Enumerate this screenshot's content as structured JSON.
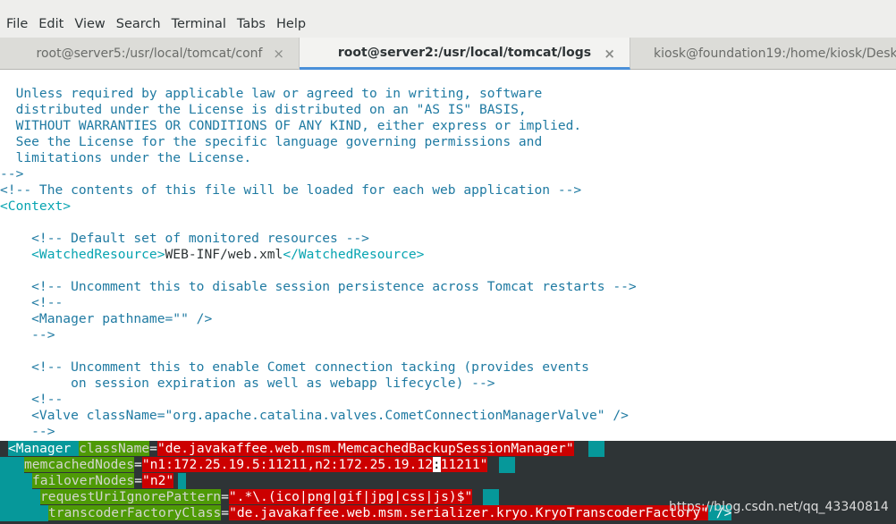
{
  "menu": [
    "File",
    "Edit",
    "View",
    "Search",
    "Terminal",
    "Tabs",
    "Help"
  ],
  "tabs": [
    {
      "label": "root@server5:/usr/local/tomcat/conf",
      "active": false,
      "close": "×"
    },
    {
      "label": "root@server2:/usr/local/tomcat/logs",
      "active": true,
      "close": "×"
    },
    {
      "label": "kiosk@foundation19:/home/kiosk/Deskt",
      "active": false
    }
  ],
  "terminal": {
    "l1": "  Unless required by applicable law or agreed to in writing, software",
    "l2": "  distributed under the License is distributed on an \"AS IS\" BASIS,",
    "l3": "  WITHOUT WARRANTIES OR CONDITIONS OF ANY KIND, either express or implied.",
    "l4": "  See the License for the specific language governing permissions and",
    "l5": "  limitations under the License.",
    "l6": "-->",
    "l7": "<!-- The contents of this file will be loaded for each web application -->",
    "l8": "<Context>",
    "l10": "    <!-- Default set of monitored resources -->",
    "l11_open": "    <WatchedResource>",
    "l11_text": "WEB-INF/web.xml",
    "l11_close": "</WatchedResource>",
    "l13": "    <!-- Uncomment this to disable session persistence across Tomcat restarts -->",
    "l14": "    <!--",
    "l15": "    <Manager pathname=\"\" />",
    "l16": "    -->",
    "l18": "    <!-- Uncomment this to enable Comet connection tacking (provides events",
    "l19": "         on session expiration as well as webapp lifecycle) -->",
    "l20": "    <!--",
    "l21": "    <Valve className=\"org.apache.catalina.valves.CometConnectionManagerValve\" />",
    "l22": "    -->"
  },
  "highlight": {
    "r1_tag": "<Manager ",
    "r1_attr": "className",
    "r1_eq": "=",
    "r1_val": "\"de.javakaffee.web.msm.MemcachedBackupSessionManager\"",
    "r2_attr": "memcachedNodes",
    "r2_eq": "=",
    "r2_val_a": "\"n1:172.25.19.5:11211,n2:172.25.19.12",
    "r2_cursor": ":",
    "r2_val_b": "11211\"",
    "r3_attr": "failoverNodes",
    "r3_eq": "=",
    "r3_val": "\"n2\"",
    "r4_attr": "requestUriIgnorePattern",
    "r4_eq": "=",
    "r4_val": "\".*\\.(ico|png|gif|jpg|css|js)$\"",
    "r5_attr": "transcoderFactoryClass",
    "r5_eq": "=",
    "r5_val": "\"de.javakaffee.web.msm.serializer.kryo.KryoTranscoderFactory\"",
    "r5_end": " />"
  },
  "watermark": "https://blog.csdn.net/qq_43340814",
  "colors": {
    "comment": "#1f7aa2",
    "tag": "#07a4b1",
    "highlight_teal": "#06989a",
    "highlight_green": "#4e9a06",
    "highlight_red": "#cc0000",
    "active_tab_underline": "#4a90d9"
  }
}
